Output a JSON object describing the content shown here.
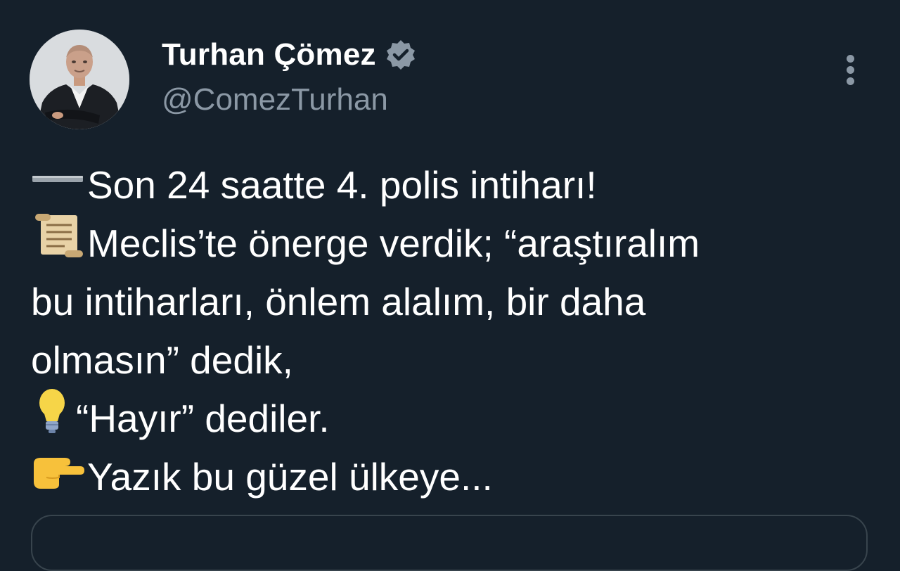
{
  "user": {
    "display_name": "Turhan Çömez",
    "handle": "@ComezTurhan",
    "verified": true,
    "avatar": "profile-photo"
  },
  "menu_icon": "more-vertical-icon",
  "tweet": {
    "lines": [
      {
        "emoji": "minus-emoji",
        "text": "Son 24 saatte 4. polis intiharı!"
      },
      {
        "emoji": "scroll-emoji",
        "text": "Meclis’te önerge verdik; “araştıralım"
      },
      {
        "emoji": "",
        "text": "bu intiharları, önlem alalım, bir daha"
      },
      {
        "emoji": "",
        "text": "olmasın” dedik,"
      },
      {
        "emoji": "light-bulb-emoji",
        "text": " “Hayır” dediler."
      },
      {
        "emoji": "pointing-right-emoji",
        "text": "Yazık bu güzel ülkeye..."
      }
    ]
  },
  "colors": {
    "background": "#15202b",
    "text": "#ffffff",
    "secondary_text": "#8b98a5",
    "verified_badge": "#8b98a5",
    "border": "#38444d"
  }
}
